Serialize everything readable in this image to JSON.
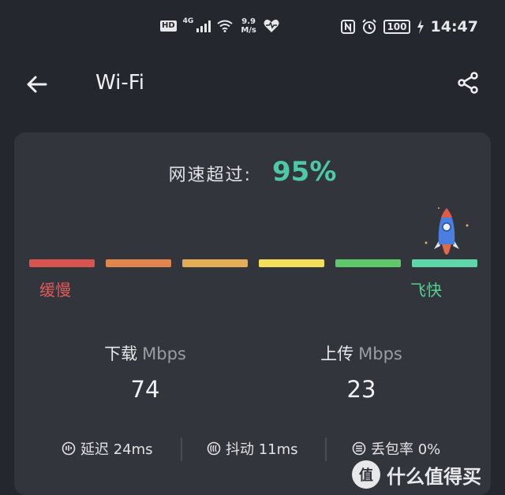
{
  "status_bar": {
    "hd": "HD",
    "network_type": "4G",
    "net_speed_value": "9.9",
    "net_speed_unit": "M/s",
    "battery": "100",
    "time": "14:47"
  },
  "header": {
    "title": "Wi-Fi"
  },
  "result": {
    "label": "网速超过:",
    "value": "95%",
    "percentile": 95
  },
  "speed_scale": {
    "segments": [
      {
        "color": "#d9534f"
      },
      {
        "color": "#e0844e"
      },
      {
        "color": "#e3ad55"
      },
      {
        "color": "#f2e05a"
      },
      {
        "color": "#5fc96a"
      },
      {
        "color": "#5fd6a8"
      }
    ],
    "slow_label": "缓慢",
    "fast_label": "飞快"
  },
  "download": {
    "label": "下载",
    "unit": "Mbps",
    "value": "74"
  },
  "upload": {
    "label": "上传",
    "unit": "Mbps",
    "value": "23"
  },
  "metrics": {
    "latency": "延迟 24ms",
    "jitter": "抖动 11ms",
    "packet_loss": "丢包率 0%"
  },
  "watermark": {
    "logo": "值",
    "text": "什么值得买"
  },
  "colors": {
    "accent": "#4ec9a6",
    "background": "#25272e",
    "card": "#33353d",
    "slow": "#e05a5a",
    "fast": "#59d08f"
  }
}
